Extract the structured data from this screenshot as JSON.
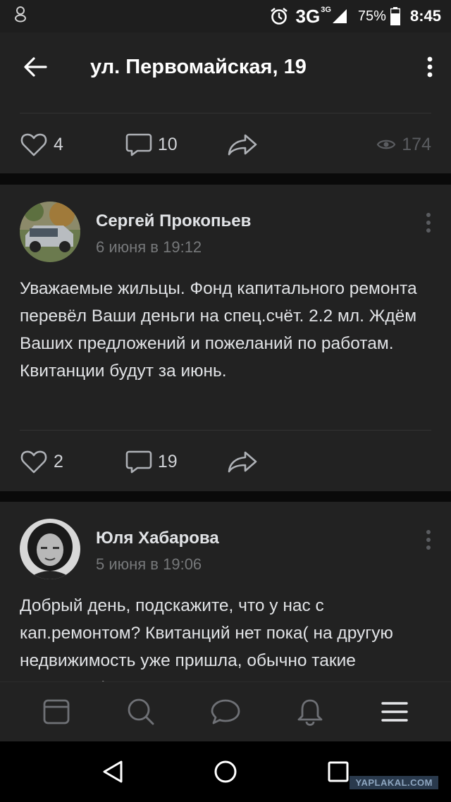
{
  "status_bar": {
    "network": "3G",
    "network_sup": "3G",
    "battery": "75%",
    "time": "8:45"
  },
  "header": {
    "title": "ул. Первомайская, 19"
  },
  "first_post_actions": {
    "likes": "4",
    "comments": "10",
    "views": "174"
  },
  "posts": [
    {
      "author": "Сергей Прокопьев",
      "date": "6 июня в 19:12",
      "text": "Уважаемые жильцы. Фонд капитального ремонта перевёл Ваши деньги на спец.счёт. 2.2 мл. Ждём Ваших предложений и пожеланий по работам. Квитанции будут за июнь.",
      "likes": "2",
      "comments": "19"
    },
    {
      "author": "Юля Хабарова",
      "date": "5 июня в 19:06",
      "text": "Добрый день, подскажите, что у нас с кап.ремонтом? Квитанций нет пока( на другую недвижимость уже пришла, обычно такие квитанции)"
    }
  ],
  "watermark": "YAPLAKAL.COM"
}
